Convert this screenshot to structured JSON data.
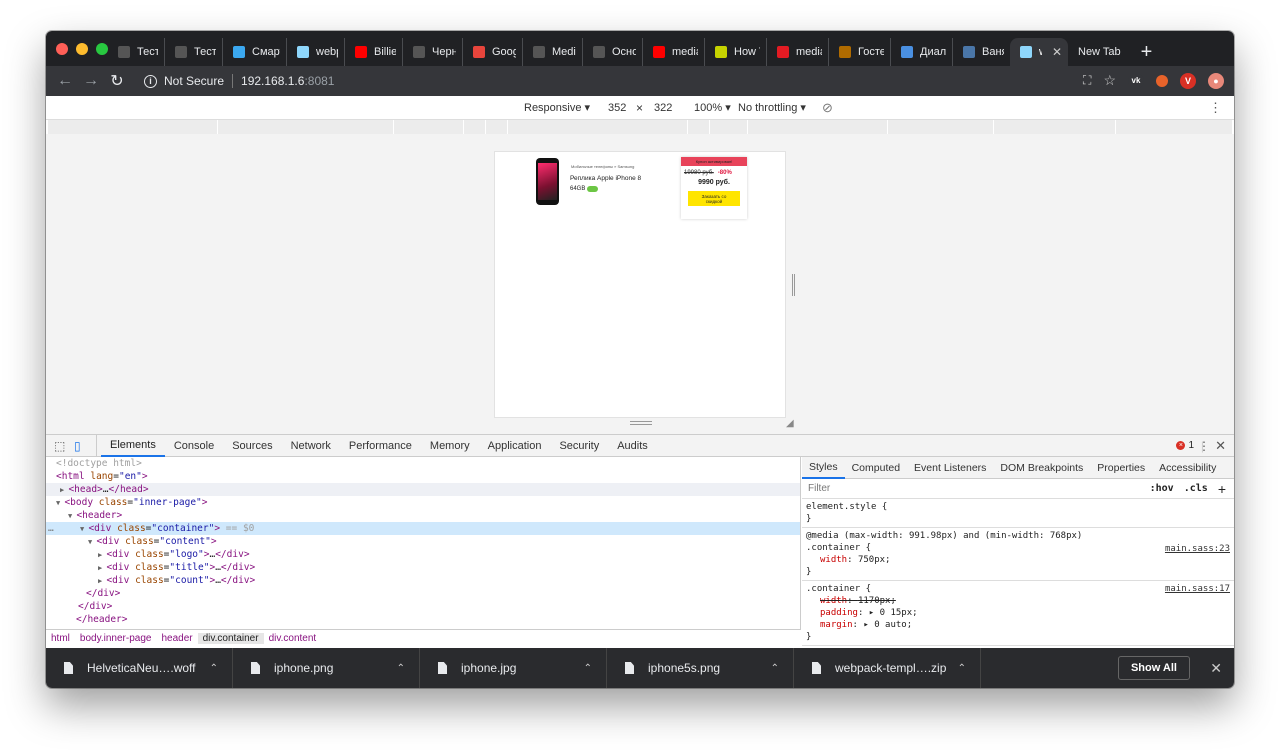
{
  "tabs": [
    {
      "label": "Тесто",
      "icon": "gmail-icon",
      "color": "#ffffff"
    },
    {
      "label": "Тесто",
      "icon": "globe-icon",
      "color": "#ffffff"
    },
    {
      "label": "Смарт",
      "icon": "rocket-icon",
      "color": "#3ba8f0"
    },
    {
      "label": "webpa",
      "icon": "webpack-icon",
      "color": "#8ed6fb"
    },
    {
      "label": "Billie E",
      "icon": "youtube-icon",
      "color": "#ff0000"
    },
    {
      "label": "Черно",
      "icon": "gmail-icon",
      "color": "#ffffff"
    },
    {
      "label": "Google",
      "icon": "f-icon",
      "color": "#e8453c"
    },
    {
      "label": "Media",
      "icon": "css-icon",
      "color": "#ffffff"
    },
    {
      "label": "Осно",
      "icon": "code-icon",
      "color": "#ffffff"
    },
    {
      "label": "media",
      "icon": "youtube-icon",
      "color": "#ff0000"
    },
    {
      "label": "How T",
      "icon": "circle-icon",
      "color": "#c6d300"
    },
    {
      "label": "media",
      "icon": "p-icon",
      "color": "#e31b23"
    },
    {
      "label": "Гостев",
      "icon": "bar-icon",
      "color": "#b06b00"
    },
    {
      "label": "Диало",
      "icon": "chat-icon",
      "color": "#4a90e2"
    },
    {
      "label": "Ваня",
      "icon": "vk-icon",
      "color": "#4a76a8"
    },
    {
      "label": "we",
      "icon": "webpack-icon",
      "color": "#8ed6fb",
      "active": true
    },
    {
      "label": "New Tab",
      "icon": "",
      "color": ""
    }
  ],
  "address": {
    "security": "Not Secure",
    "host": "192.168.1.6",
    "port": ":8081"
  },
  "device": {
    "mode": "Responsive",
    "width": "352",
    "x": "×",
    "height": "322",
    "zoom": "100%",
    "throttle": "No throttling"
  },
  "page": {
    "breadcrumb": "Мобильные телефоны  »  Samsung",
    "title": "Реплика Apple iPhone 8",
    "memory": "64GB",
    "badge": "Купон активирован!",
    "old_price": "19980 руб.",
    "discount": "-80%",
    "price": "9990 руб.",
    "button": "Заказать со скидкой"
  },
  "devtools": {
    "tabs": [
      "Elements",
      "Console",
      "Sources",
      "Network",
      "Performance",
      "Memory",
      "Application",
      "Security",
      "Audits"
    ],
    "errors": "1",
    "dom": [
      {
        "pre": "",
        "html": "<!doctype html>"
      },
      {
        "pre": "",
        "html": "<html lang=\"en\">"
      },
      {
        "pre": "▶",
        "html": "<head>…</head>"
      },
      {
        "pre": "▼",
        "html": "<body class=\"inner-page\">"
      },
      {
        "pre": "▼",
        "html": "<header>"
      },
      {
        "pre": "▼",
        "html": "<div class=\"container\"> == $0"
      },
      {
        "pre": "▼",
        "html": "<div class=\"content\">"
      },
      {
        "pre": "▶",
        "html": "<div class=\"logo\">…</div>"
      },
      {
        "pre": "▶",
        "html": "<div class=\"title\">…</div>"
      },
      {
        "pre": "▶",
        "html": "<div class=\"count\">…</div>"
      },
      {
        "pre": "",
        "html": "</div>"
      },
      {
        "pre": "",
        "html": "</div>"
      },
      {
        "pre": "",
        "html": "</header>"
      }
    ],
    "crumbs": [
      "html",
      "body.inner-page",
      "header",
      "div.container",
      "div.content"
    ],
    "style_tabs": [
      "Styles",
      "Computed",
      "Event Listeners",
      "DOM Breakpoints",
      "Properties",
      "Accessibility"
    ],
    "filter": "Filter",
    "hov": ":hov",
    "cls": ".cls",
    "rules": [
      {
        "selector": "element.style {",
        "src": "",
        "props": [],
        "close": "}"
      },
      {
        "selector": "@media (max-width: 991.98px) and (min-width: 768px)",
        "selector2": ".container {",
        "src": "main.sass:23",
        "props": [
          {
            "n": "width",
            "v": "750px;",
            "s": false
          }
        ],
        "close": "}"
      },
      {
        "selector": ".container {",
        "src": "main.sass:17",
        "props": [
          {
            "n": "width",
            "v": "1170px;",
            "s": true
          },
          {
            "n": "padding",
            "v": "▸ 0 15px;",
            "s": false
          },
          {
            "n": "margin",
            "v": "▸ 0 auto;",
            "s": false
          }
        ],
        "close": "}"
      }
    ]
  },
  "downloads": {
    "items": [
      "HelveticaNeu….woff",
      "iphone.png",
      "iphone.jpg",
      "iphone5s.png",
      "webpack-templ….zip"
    ],
    "show_all": "Show All"
  }
}
